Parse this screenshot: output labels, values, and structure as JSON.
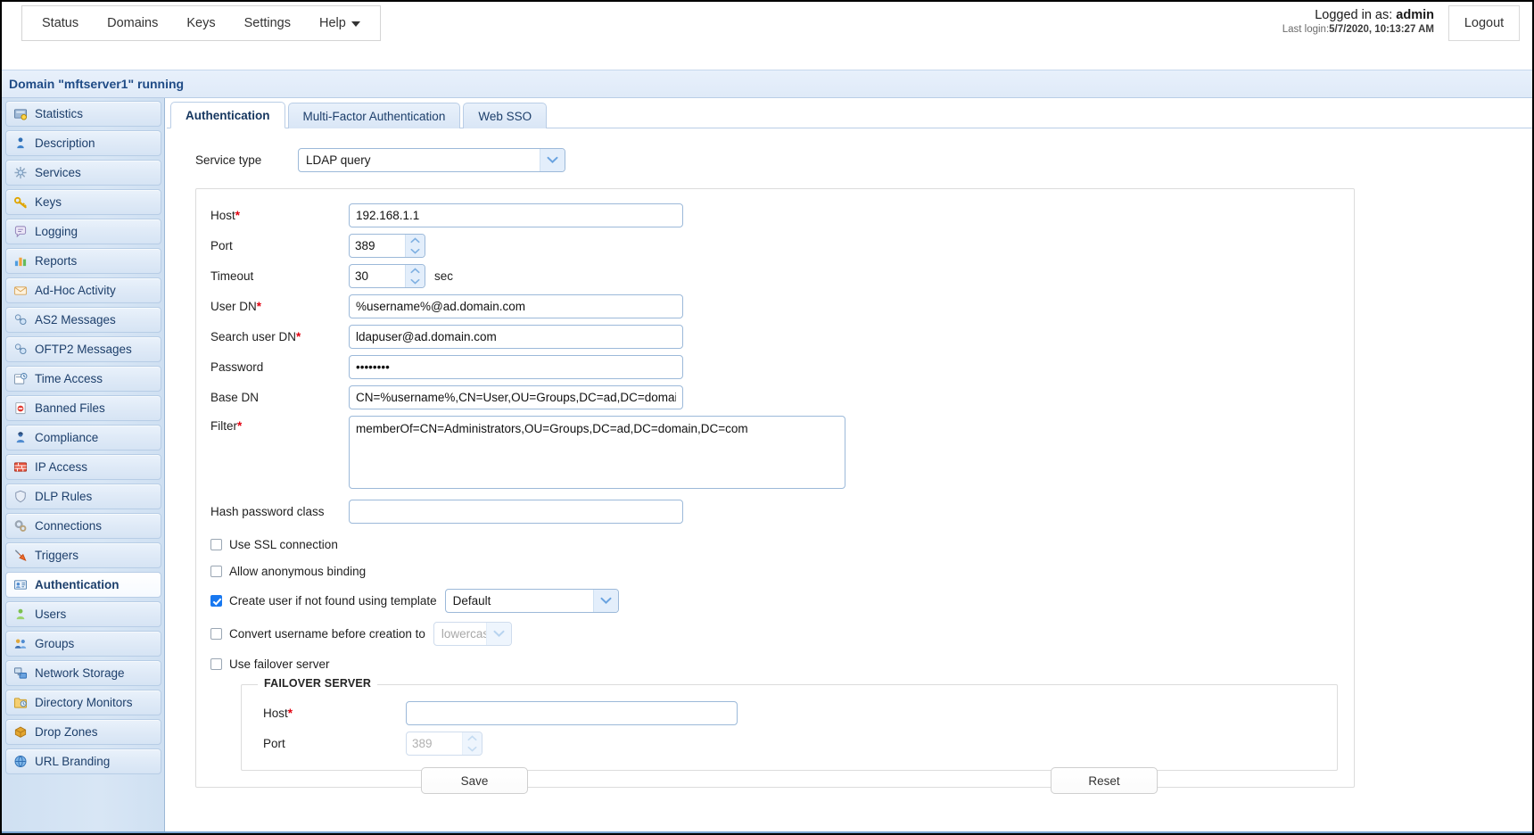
{
  "topbar": {
    "menu": [
      {
        "label": "Status",
        "has_caret": false
      },
      {
        "label": "Domains",
        "has_caret": false
      },
      {
        "label": "Keys",
        "has_caret": false
      },
      {
        "label": "Settings",
        "has_caret": false
      },
      {
        "label": "Help",
        "has_caret": true
      }
    ],
    "logged_in_prefix": "Logged in as: ",
    "logged_in_user": "admin",
    "last_login_prefix": "Last login:",
    "last_login_value": "5/7/2020, 10:13:27 AM",
    "logout_label": "Logout"
  },
  "domain_strip": {
    "text": "Domain \"mftserver1\" running"
  },
  "sidebar": {
    "items": [
      {
        "label": "Statistics",
        "icon": "statistics-icon",
        "active": false
      },
      {
        "label": "Description",
        "icon": "description-icon",
        "active": false
      },
      {
        "label": "Services",
        "icon": "services-icon",
        "active": false
      },
      {
        "label": "Keys",
        "icon": "keys-icon",
        "active": false
      },
      {
        "label": "Logging",
        "icon": "logging-icon",
        "active": false
      },
      {
        "label": "Reports",
        "icon": "reports-icon",
        "active": false
      },
      {
        "label": "Ad-Hoc Activity",
        "icon": "adhoc-activity-icon",
        "active": false
      },
      {
        "label": "AS2 Messages",
        "icon": "as2-messages-icon",
        "active": false
      },
      {
        "label": "OFTP2 Messages",
        "icon": "oftp2-messages-icon",
        "active": false
      },
      {
        "label": "Time Access",
        "icon": "time-access-icon",
        "active": false
      },
      {
        "label": "Banned Files",
        "icon": "banned-files-icon",
        "active": false
      },
      {
        "label": "Compliance",
        "icon": "compliance-icon",
        "active": false
      },
      {
        "label": "IP Access",
        "icon": "ip-access-icon",
        "active": false
      },
      {
        "label": "DLP Rules",
        "icon": "dlp-rules-icon",
        "active": false
      },
      {
        "label": "Connections",
        "icon": "connections-icon",
        "active": false
      },
      {
        "label": "Triggers",
        "icon": "triggers-icon",
        "active": false
      },
      {
        "label": "Authentication",
        "icon": "authentication-icon",
        "active": true
      },
      {
        "label": "Users",
        "icon": "users-icon",
        "active": false
      },
      {
        "label": "Groups",
        "icon": "groups-icon",
        "active": false
      },
      {
        "label": "Network Storage",
        "icon": "network-storage-icon",
        "active": false
      },
      {
        "label": "Directory Monitors",
        "icon": "directory-monitors-icon",
        "active": false
      },
      {
        "label": "Drop Zones",
        "icon": "drop-zones-icon",
        "active": false
      },
      {
        "label": "URL Branding",
        "icon": "url-branding-icon",
        "active": false
      }
    ]
  },
  "tabs": [
    {
      "label": "Authentication",
      "active": true
    },
    {
      "label": "Multi-Factor Authentication",
      "active": false
    },
    {
      "label": "Web SSO",
      "active": false
    }
  ],
  "form": {
    "service_type_label": "Service type",
    "service_type_value": "LDAP query",
    "host_label": "Host",
    "host_value": "192.168.1.1",
    "port_label": "Port",
    "port_value": "389",
    "timeout_label": "Timeout",
    "timeout_value": "30",
    "timeout_unit": "sec",
    "user_dn_label": "User DN",
    "user_dn_value": "%username%@ad.domain.com",
    "search_user_dn_label": "Search user DN",
    "search_user_dn_value": "ldapuser@ad.domain.com",
    "password_label": "Password",
    "password_value": "••••••••",
    "base_dn_label": "Base DN",
    "base_dn_value": "CN=%username%,CN=User,OU=Groups,DC=ad,DC=domain,DC=com",
    "filter_label": "Filter",
    "filter_value": "memberOf=CN=Administrators,OU=Groups,DC=ad,DC=domain,DC=com",
    "hash_password_class_label": "Hash password class",
    "hash_password_class_value": "",
    "use_ssl_label": "Use SSL connection",
    "use_ssl_checked": false,
    "allow_anon_label": "Allow anonymous binding",
    "allow_anon_checked": false,
    "create_user_label": "Create user if not found using template",
    "create_user_checked": true,
    "create_user_template": "Default",
    "convert_username_label": "Convert username before creation to",
    "convert_username_checked": false,
    "convert_username_value": "lowercase",
    "use_failover_label": "Use failover server",
    "use_failover_checked": false,
    "required_marker": "*"
  },
  "failover": {
    "legend": "FAILOVER SERVER",
    "host_label": "Host",
    "host_value": "",
    "host_placeholder": "",
    "port_label": "Port",
    "port_value": "",
    "port_placeholder": "389"
  },
  "buttons": {
    "save_label": "Save",
    "reset_label": "Reset"
  },
  "colors": {
    "accent_blue": "#1878f0",
    "header_blue": "#1f4b86",
    "required_red": "#e2000f",
    "sidebar_blue": "#d8e6f5"
  }
}
